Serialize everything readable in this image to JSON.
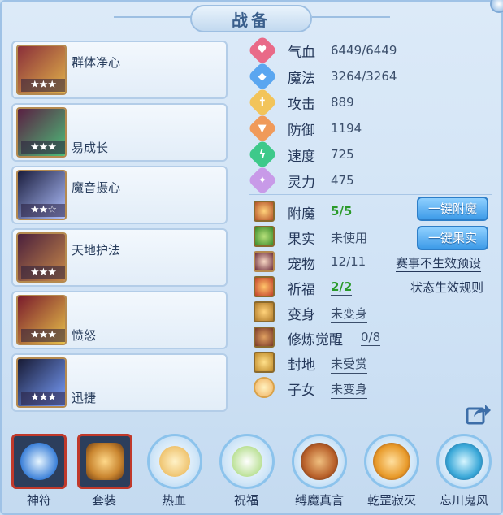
{
  "window": {
    "title": "战备"
  },
  "skills": [
    {
      "name": "群体净心",
      "stars": "★★★",
      "art_colors": [
        "#8a2f3a",
        "#e2b34a"
      ]
    },
    {
      "name": "易成长",
      "stars": "★★★",
      "art_colors": [
        "#5a1f42",
        "#4dc07a"
      ]
    },
    {
      "name": "魔音摄心",
      "stars": "★★☆",
      "art_colors": [
        "#1b1e3e",
        "#b0c0ff"
      ]
    },
    {
      "name": "天地护法",
      "stars": "★★★",
      "art_colors": [
        "#4a1f3c",
        "#c98a4a"
      ]
    },
    {
      "name": "愤怒",
      "stars": "★★★",
      "art_colors": [
        "#7a1c2c",
        "#e8c24a"
      ]
    },
    {
      "name": "迅捷",
      "stars": "★★★",
      "art_colors": [
        "#171a34",
        "#7aa0ff"
      ]
    }
  ],
  "stats": [
    {
      "label": "气血",
      "value": "6449/6449",
      "icon": "heart-icon",
      "color": "#e96a88"
    },
    {
      "label": "魔法",
      "value": "3264/3264",
      "icon": "mana-icon",
      "color": "#5aa6f0"
    },
    {
      "label": "攻击",
      "value": "889",
      "icon": "sword-icon",
      "color": "#f2c45a"
    },
    {
      "label": "防御",
      "value": "1194",
      "icon": "shield-icon",
      "color": "#f09a5a"
    },
    {
      "label": "速度",
      "value": "725",
      "icon": "lightning-icon",
      "color": "#3ec98a"
    },
    {
      "label": "灵力",
      "value": "475",
      "icon": "spirit-icon",
      "color": "#c89ae8"
    }
  ],
  "features": {
    "enchant": {
      "label": "附魔",
      "value": "5/5",
      "button": "一键附魔"
    },
    "fruit": {
      "label": "果实",
      "value": "未使用",
      "button": "一键果实"
    },
    "pet": {
      "label": "宠物",
      "value": "12/11",
      "link": "赛事不生效预设"
    },
    "blessing": {
      "label": "祈福",
      "value": "2/2",
      "link": "状态生效规则"
    },
    "transform": {
      "label": "变身",
      "value": "未变身"
    },
    "cultivation": {
      "label": "修炼觉醒",
      "value": "0/8"
    },
    "territory": {
      "label": "封地",
      "value": "未受赏"
    },
    "child": {
      "label": "子女",
      "value": "未变身"
    }
  },
  "bottom_tabs": [
    {
      "label": "神符",
      "style": "square",
      "color": "#3a7fd8"
    },
    {
      "label": "套装",
      "style": "square",
      "color": "#c9852f"
    },
    {
      "label": "热血",
      "style": "round",
      "color": "#e8b04a"
    },
    {
      "label": "祝福",
      "style": "round",
      "color": "#9ed46a"
    },
    {
      "label": "缚魔真言",
      "style": "round",
      "color": "#b8602a"
    },
    {
      "label": "乾罡寂灭",
      "style": "round",
      "color": "#e89a2a"
    },
    {
      "label": "忘川鬼风",
      "style": "round",
      "color": "#3aa8d8"
    }
  ]
}
